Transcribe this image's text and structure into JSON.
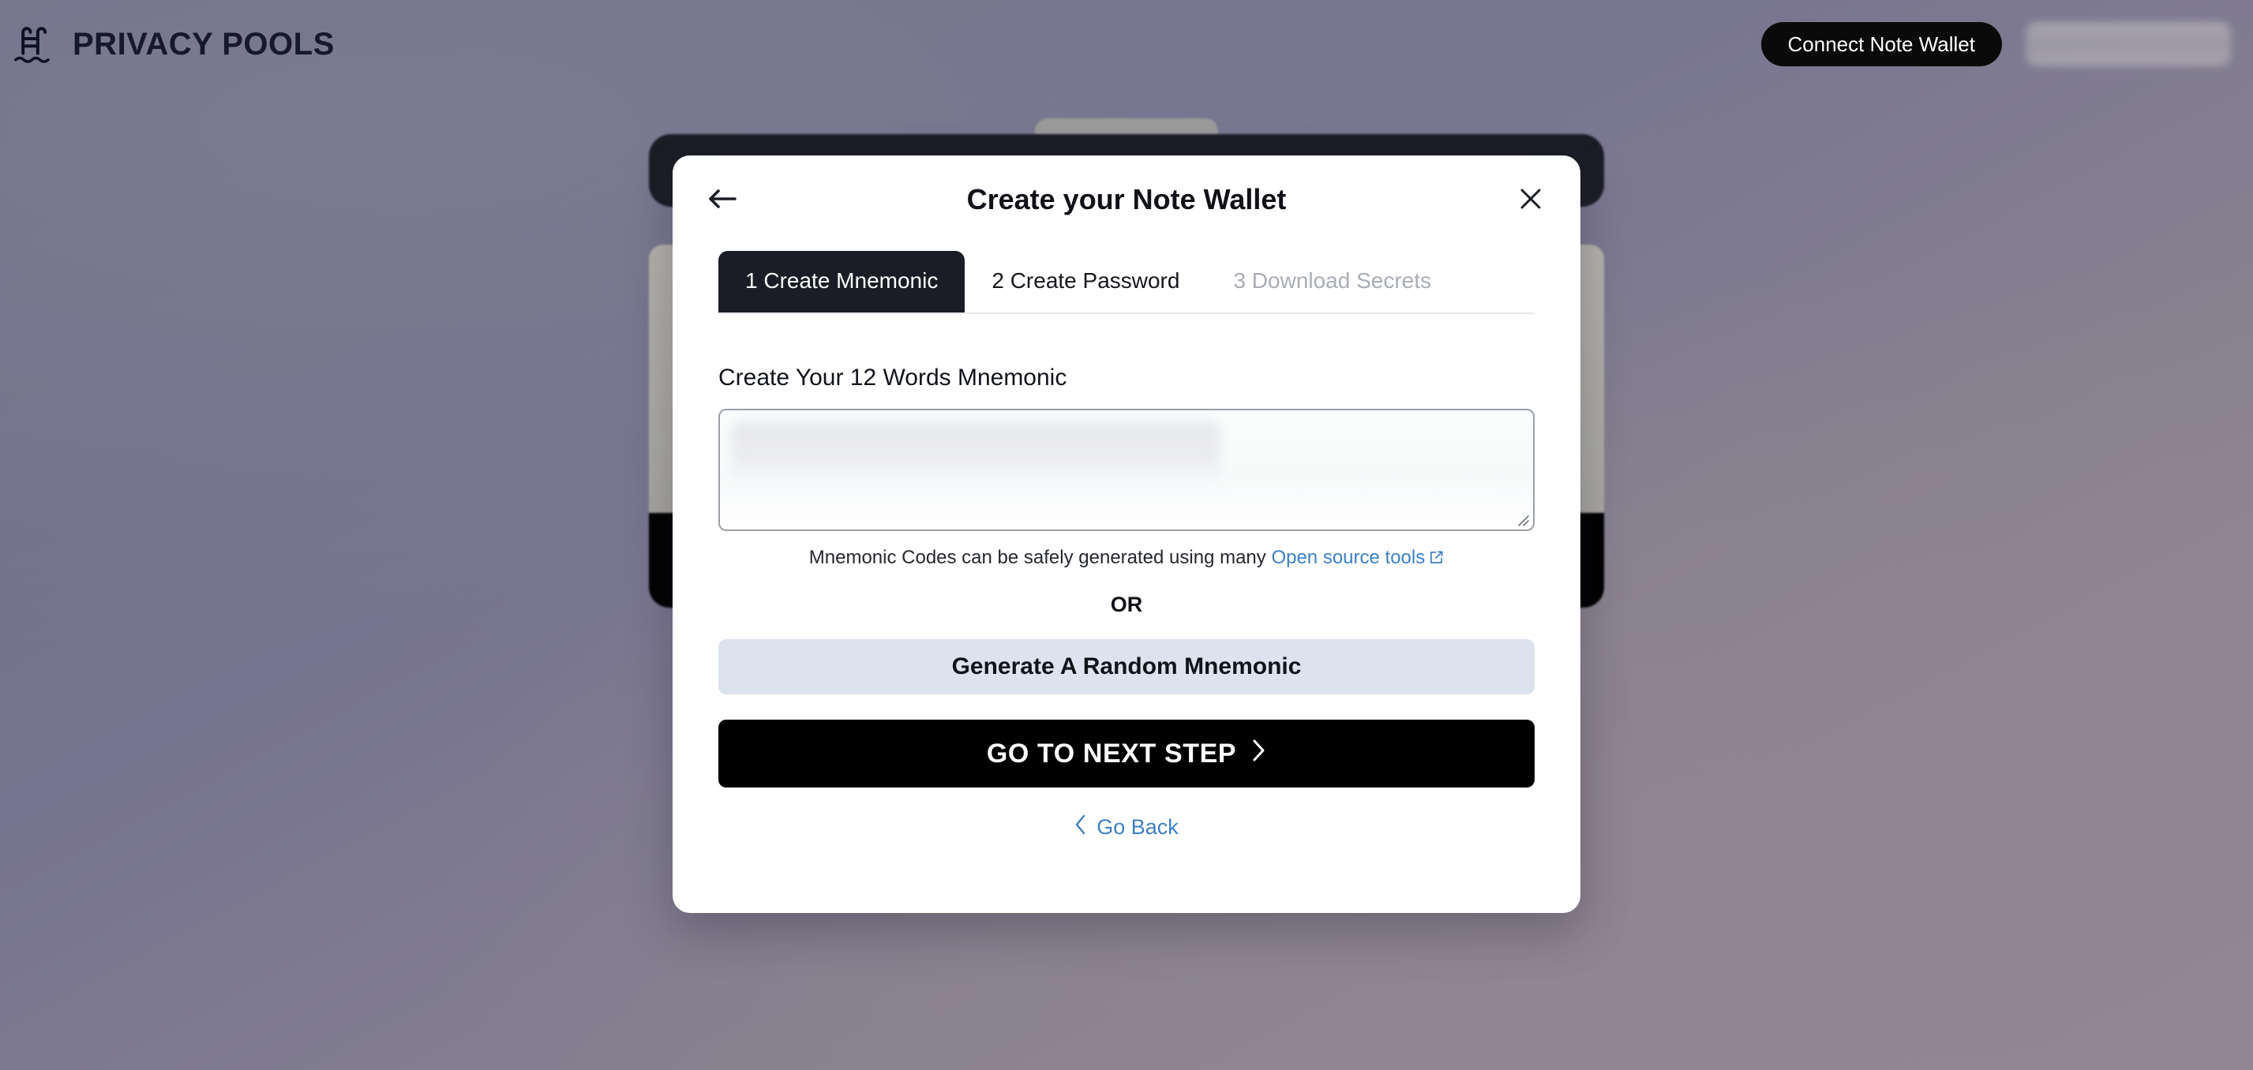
{
  "header": {
    "brand_name": "PRIVACY POOLS",
    "logo_icon": "pool-ladder-icon",
    "connect_button": "Connect Note Wallet",
    "account_chip_redacted": ""
  },
  "modal": {
    "title": "Create your Note Wallet",
    "back_icon": "arrow-left-icon",
    "close_icon": "close-icon",
    "tabs": [
      {
        "label": "1 Create Mnemonic",
        "state": "active"
      },
      {
        "label": "2 Create Password",
        "state": "enabled"
      },
      {
        "label": "3 Download Secrets",
        "state": "disabled"
      }
    ],
    "mnemonic": {
      "label": "Create Your 12 Words Mnemonic",
      "value": "",
      "placeholder": "",
      "resize_handle_icon": "resize-grip-icon"
    },
    "hint": {
      "text": "Mnemonic Codes can be safely generated using many",
      "link_text": "Open source tools",
      "link_icon": "external-link-icon"
    },
    "divider_label": "OR",
    "generate_button": "Generate A Random Mnemonic",
    "next_button": "GO TO NEXT STEP",
    "next_button_icon": "chevron-right-icon",
    "go_back": {
      "label": "Go Back",
      "icon": "chevron-left-icon"
    }
  },
  "colors": {
    "accent_link": "#3d7fc4",
    "primary_dark": "#000000",
    "tab_active_bg": "#1b1d26",
    "generate_bg": "#dde3ee",
    "page_bg": "#6f7187"
  }
}
